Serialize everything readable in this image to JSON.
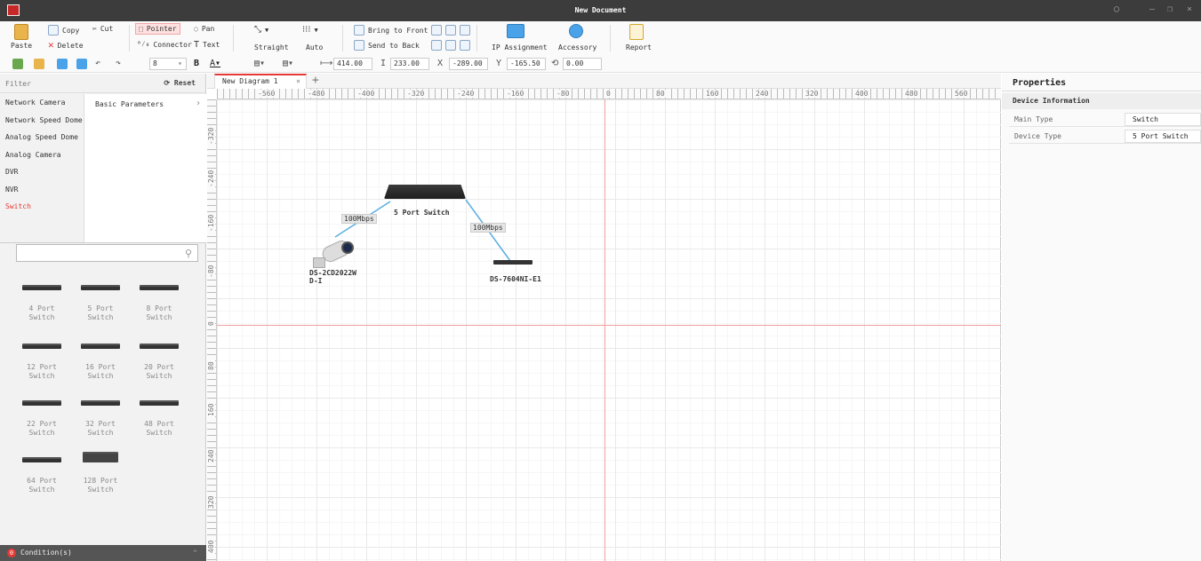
{
  "title": "New Document",
  "ribbon": {
    "paste": "Paste",
    "copy": "Copy",
    "cut": "Cut",
    "delete": "Delete",
    "pointer": "Pointer",
    "pan": "Pan",
    "connector": "Connector",
    "text": "Text",
    "straight": "Straight",
    "auto": "Auto",
    "bring_to_front": "Bring to Front",
    "send_to_back": "Send to Back",
    "ip_assignment": "IP Assignment",
    "accessory": "Accessory",
    "report": "Report"
  },
  "toolbar": {
    "font_size": "8",
    "width": "414.00",
    "height": "233.00",
    "x": "-289.00",
    "y": "-165.50",
    "angle": "0.00"
  },
  "left_panel": {
    "filter": "Filter",
    "reset": "Reset",
    "categories": [
      "Network Camera",
      "Network Speed Dome",
      "Analog Speed Dome",
      "Analog Camera",
      "DVR",
      "NVR",
      "Switch"
    ],
    "params_label": "Basic Parameters",
    "devices": [
      {
        "line1": "4 Port",
        "line2": "Switch"
      },
      {
        "line1": "5 Port",
        "line2": "Switch"
      },
      {
        "line1": "8 Port",
        "line2": "Switch"
      },
      {
        "line1": "12 Port",
        "line2": "Switch"
      },
      {
        "line1": "16 Port",
        "line2": "Switch"
      },
      {
        "line1": "20 Port",
        "line2": "Switch"
      },
      {
        "line1": "22 Port",
        "line2": "Switch"
      },
      {
        "line1": "32 Port",
        "line2": "Switch"
      },
      {
        "line1": "48 Port",
        "line2": "Switch"
      },
      {
        "line1": "64 Port",
        "line2": "Switch"
      },
      {
        "line1": "128 Port",
        "line2": "Switch"
      }
    ],
    "condition_count": "0",
    "condition_label": "Condition(s)"
  },
  "canvas": {
    "tab_label": "New Diagram 1",
    "hruler": [
      "-560",
      "-480",
      "-400",
      "-320",
      "-240",
      "-160",
      "-80",
      "0",
      "80",
      "160",
      "240",
      "320",
      "400",
      "480",
      "560"
    ],
    "vruler": [
      "-320",
      "-240",
      "-160",
      "-80",
      "0",
      "80",
      "160",
      "240",
      "320",
      "400"
    ],
    "switch_label": "5 Port Switch",
    "link1": "100Mbps",
    "link2": "100Mbps",
    "camera_line1": "DS-2CD2022W",
    "camera_line2": "D-I",
    "nvr_label": "DS-7604NI-E1"
  },
  "properties": {
    "title": "Properties",
    "section": "Device Information",
    "rows": [
      {
        "key": "Main Type",
        "value": "Switch"
      },
      {
        "key": "Device Type",
        "value": "5 Port Switch"
      }
    ]
  }
}
